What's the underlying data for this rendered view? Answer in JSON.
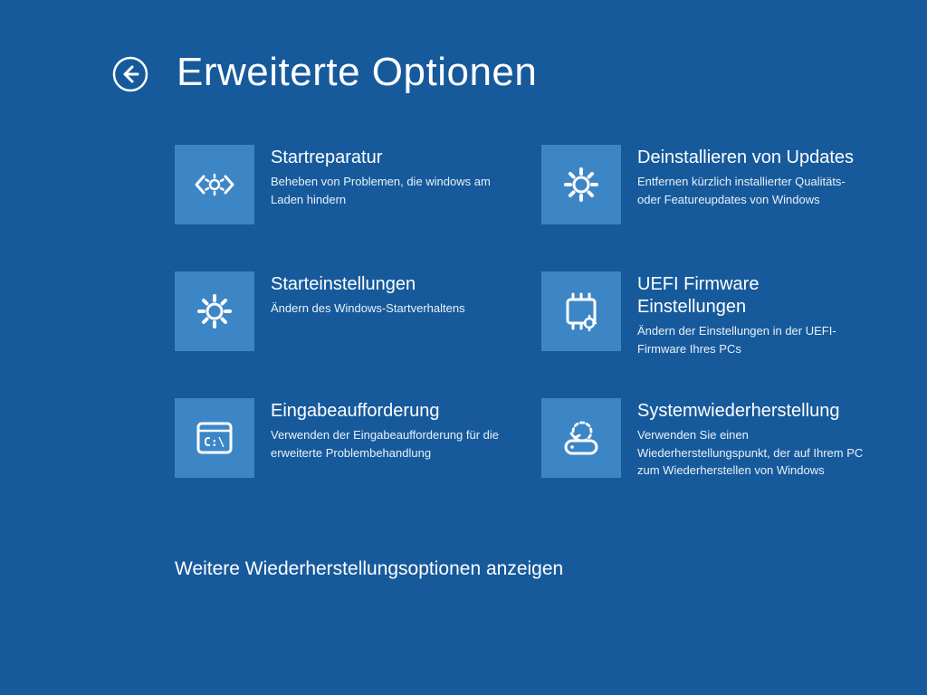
{
  "title": "Erweiterte Optionen",
  "more": "Weitere Wiederherstellungsoptionen anzeigen",
  "options": {
    "startup_repair": {
      "title": "Startreparatur",
      "desc": "Beheben von Problemen, die windows am Laden hindern"
    },
    "uninstall_updates": {
      "title": "Deinstallieren von Updates",
      "desc": "Entfernen kürzlich installierter Qualitäts- oder Featureupdates von Windows"
    },
    "startup_settings": {
      "title": "Starteinstellungen",
      "desc": "Ändern des Windows-Startverhaltens"
    },
    "uefi": {
      "title": "UEFI Firmware Einstellungen",
      "desc": "Ändern der Einstellungen in der UEFI-Firmware Ihres PCs"
    },
    "cmd": {
      "title": "Eingabeaufforderung",
      "desc": "Verwenden der Eingabeaufforderung für die erweiterte Problembehandlung"
    },
    "system_restore": {
      "title": "Systemwiederherstellung",
      "desc": "Verwenden Sie einen Wiederherstellungspunkt, der auf Ihrem PC zum Wiederherstellen von Windows"
    }
  },
  "colors": {
    "background": "#175a9c",
    "tile": "#3d86c6",
    "text": "#ffffff"
  }
}
